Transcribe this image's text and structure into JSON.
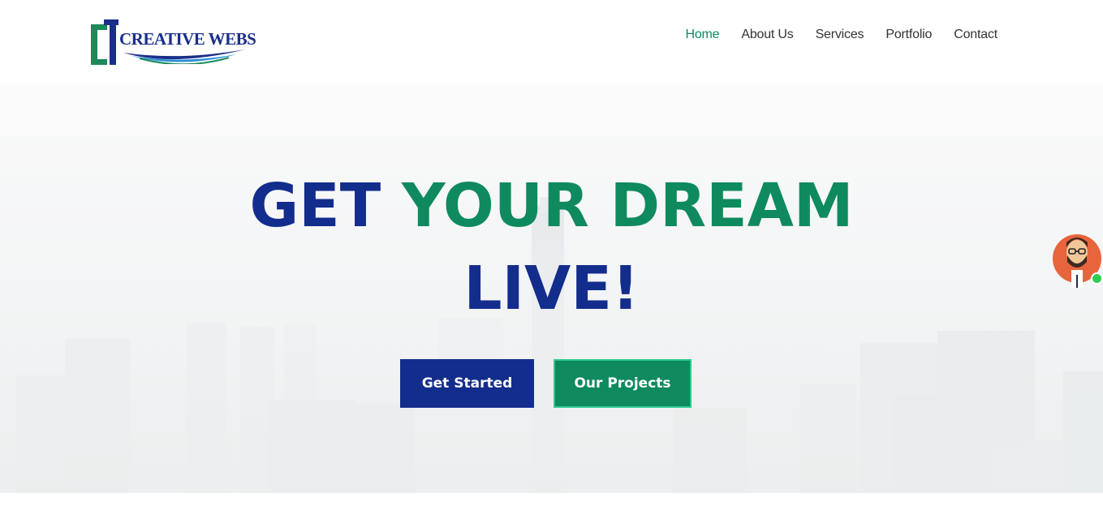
{
  "brand": {
    "logo_text_1": "CREATIVE",
    "logo_text_2": "WEBS",
    "colors": {
      "primary_blue": "#132d8c",
      "primary_green": "#0f8a5f"
    }
  },
  "nav": {
    "items": [
      {
        "label": "Home",
        "active": true
      },
      {
        "label": "About Us",
        "active": false
      },
      {
        "label": "Services",
        "active": false
      },
      {
        "label": "Portfolio",
        "active": false
      },
      {
        "label": "Contact",
        "active": false
      }
    ]
  },
  "hero": {
    "headline_part1": "GET",
    "headline_part2": "YOUR DREAM",
    "headline_part3": "LIVE!",
    "primary_button": "Get Started",
    "secondary_button": "Our Projects"
  },
  "chat_widget": {
    "icon": "support-agent-avatar-icon",
    "status": "online"
  }
}
